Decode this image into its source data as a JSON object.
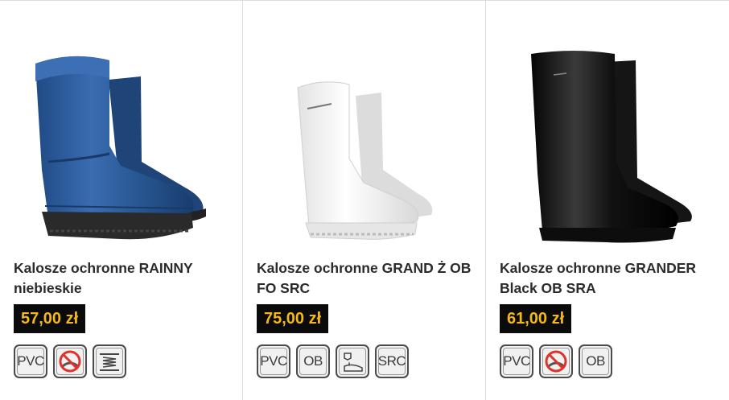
{
  "products": [
    {
      "name": "Kalosze ochronne RAINNY niebieskie",
      "price": "57,00 zł",
      "color": "#2f5fa0",
      "badges": [
        {
          "type": "text",
          "label": "PVC"
        },
        {
          "type": "icon",
          "icon": "no-slip-prohibited-icon"
        },
        {
          "type": "icon",
          "icon": "spring-insole-icon"
        }
      ]
    },
    {
      "name": "Kalosze ochronne GRAND Ż OB FO SRC",
      "price": "75,00 zł",
      "color": "#f4f4f4",
      "badges": [
        {
          "type": "text",
          "label": "PVC"
        },
        {
          "type": "text",
          "label": "OB"
        },
        {
          "type": "icon",
          "icon": "fuel-oil-resistant-icon"
        },
        {
          "type": "text",
          "label": "SRC"
        }
      ]
    },
    {
      "name": "Kalosze ochronne GRANDER Black OB SRA",
      "price": "61,00 zł",
      "color": "#111111",
      "badges": [
        {
          "type": "text",
          "label": "PVC"
        },
        {
          "type": "icon",
          "icon": "no-slip-prohibited-icon"
        },
        {
          "type": "text",
          "label": "OB"
        }
      ]
    }
  ]
}
